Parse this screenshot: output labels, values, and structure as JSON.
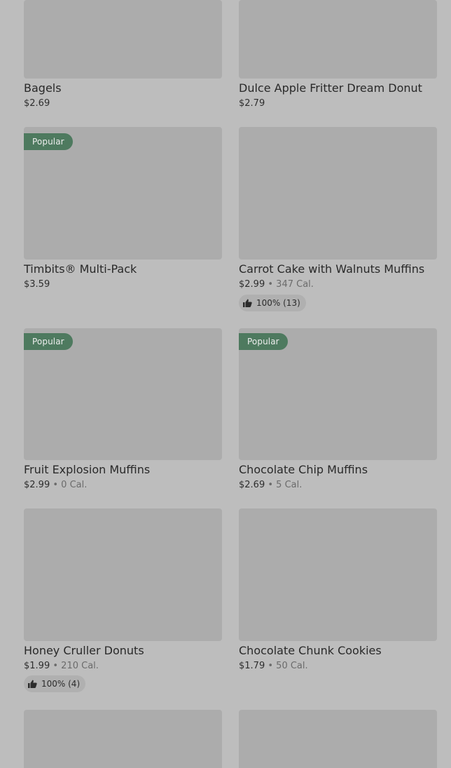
{
  "colors": {
    "background": "#bdbdbd",
    "image_placeholder": "#acacac",
    "badge": "#4e7a5f"
  },
  "items": [
    {
      "name": "Bagels",
      "price": "$2.69"
    },
    {
      "name": "Dulce Apple Fritter Dream Donut",
      "price": "$2.79"
    },
    {
      "name": "Timbits® Multi-Pack",
      "price": "$3.59",
      "badge": "Popular"
    },
    {
      "name": "Carrot Cake with Walnuts Muffins",
      "price": "$2.99",
      "sep": "•",
      "calories": "347 Cal.",
      "rating": "100% (13)",
      "rating_icon": "thumbs-up-icon"
    },
    {
      "name": "Fruit Explosion Muffins",
      "price": "$2.99",
      "sep": "•",
      "calories": "0 Cal.",
      "badge": "Popular"
    },
    {
      "name": "Chocolate Chip Muffins",
      "price": "$2.69",
      "sep": "•",
      "calories": "5 Cal.",
      "badge": "Popular"
    },
    {
      "name": "Honey Cruller Donuts",
      "price": "$1.99",
      "sep": "•",
      "calories": "210 Cal.",
      "rating": "100% (4)",
      "rating_icon": "thumbs-up-icon"
    },
    {
      "name": "Chocolate Chunk Cookies",
      "price": "$1.79",
      "sep": "•",
      "calories": "50 Cal."
    }
  ]
}
